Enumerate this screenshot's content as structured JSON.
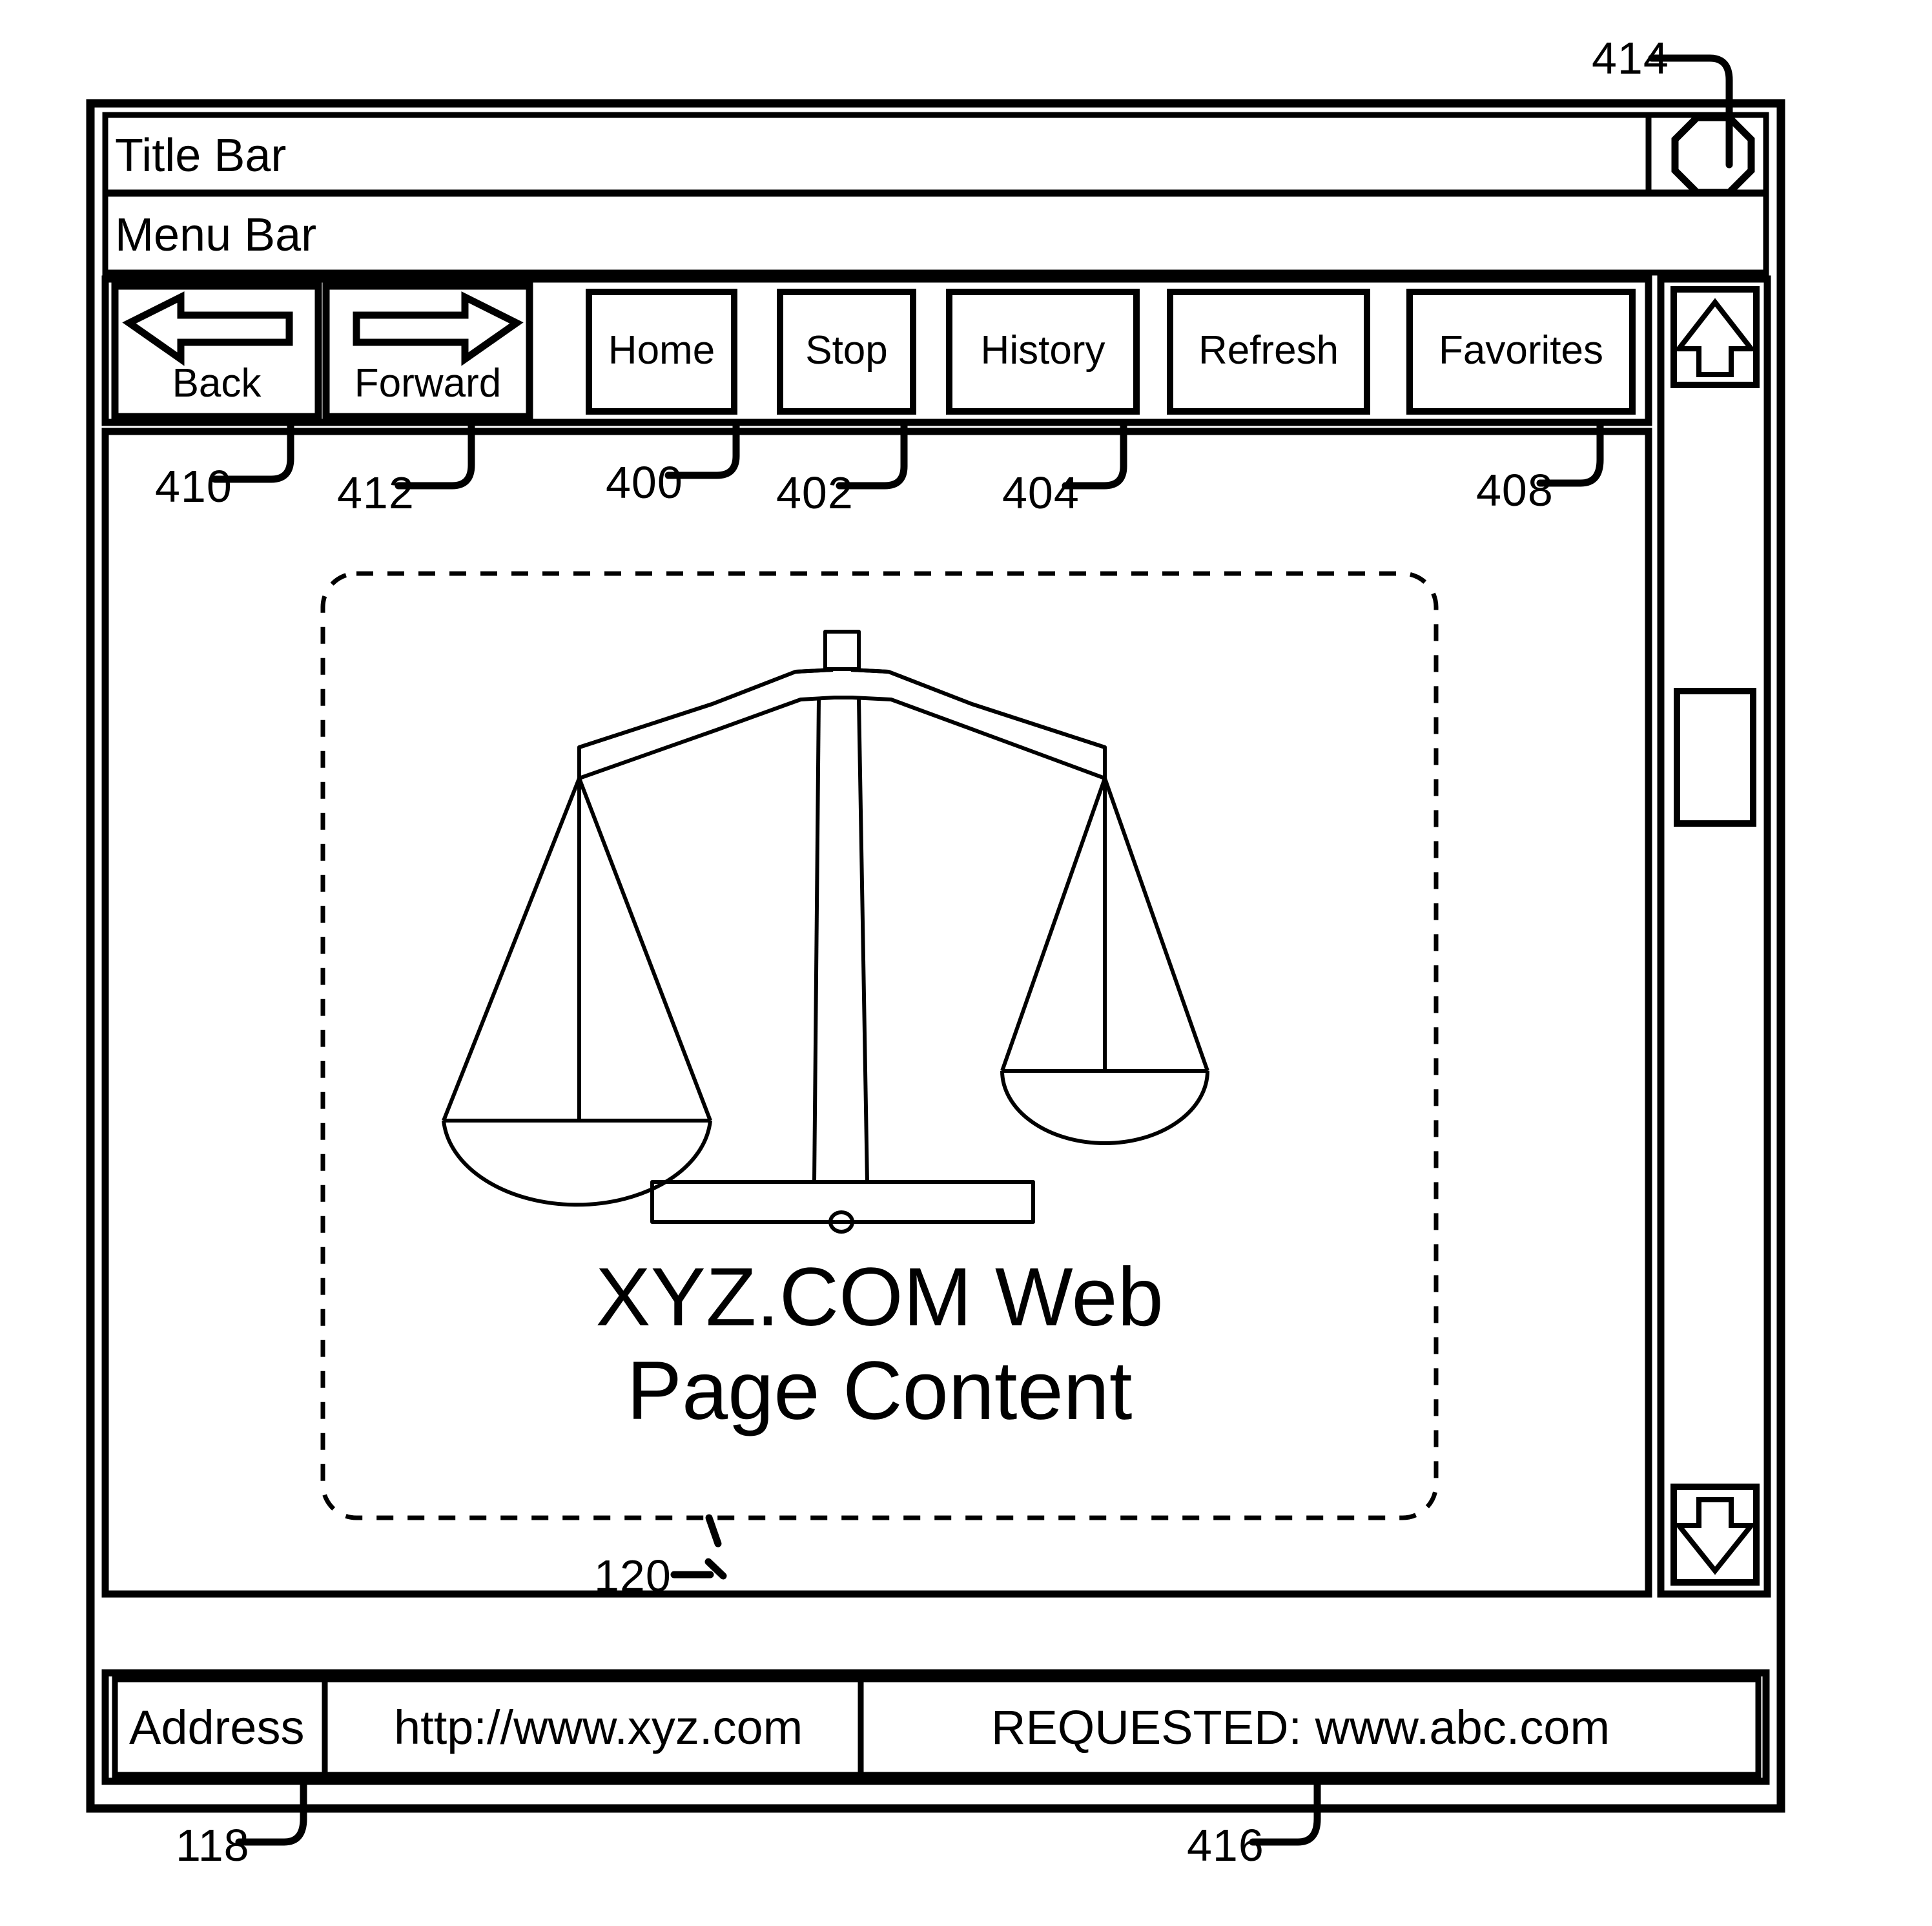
{
  "figure": {
    "type": "patent-diagram",
    "subject": "web-browser-window"
  },
  "window": {
    "title_bar_label": "Title Bar",
    "menu_bar_label": "Menu Bar",
    "control_button_icon": "octagon-icon"
  },
  "toolbar": {
    "buttons": [
      {
        "label": "Back",
        "icon": "arrow-left-icon",
        "ref": "410"
      },
      {
        "label": "Forward",
        "icon": "arrow-right-icon",
        "ref": "412"
      },
      {
        "label": "Home",
        "icon": "",
        "ref": "400"
      },
      {
        "label": "Stop",
        "icon": "",
        "ref": "402"
      },
      {
        "label": "History",
        "icon": "",
        "ref": "404"
      },
      {
        "label": "Refresh",
        "icon": "",
        "ref": ""
      },
      {
        "label": "Favorites",
        "icon": "",
        "ref": "408"
      }
    ]
  },
  "scrollbar": {
    "up_arrow_icon": "arrow-up-icon",
    "down_arrow_icon": "arrow-down-icon",
    "thumb_icon": "scrollbar-thumb"
  },
  "content": {
    "graphic_icon": "balance-scales-icon",
    "line1": "XYZ.COM Web",
    "line2": "Page Content",
    "ref": "120"
  },
  "status_bar": {
    "address_label": "Address",
    "address_value": "http://www.xyz.com",
    "address_ref": "118",
    "requested_text": "REQUESTED:  www.abc.com",
    "requested_ref": "416"
  },
  "callouts": [
    {
      "ref": "414",
      "target": "window-control-button"
    },
    {
      "ref": "410",
      "target": "back-button"
    },
    {
      "ref": "412",
      "target": "forward-button"
    },
    {
      "ref": "400",
      "target": "home-button"
    },
    {
      "ref": "402",
      "target": "stop-button"
    },
    {
      "ref": "404",
      "target": "history-button"
    },
    {
      "ref": "408",
      "target": "favorites-button"
    },
    {
      "ref": "120",
      "target": "web-page-content-region"
    },
    {
      "ref": "118",
      "target": "address-field"
    },
    {
      "ref": "416",
      "target": "requested-field"
    }
  ],
  "colors": {
    "ink": "#000000",
    "paper": "#ffffff"
  }
}
